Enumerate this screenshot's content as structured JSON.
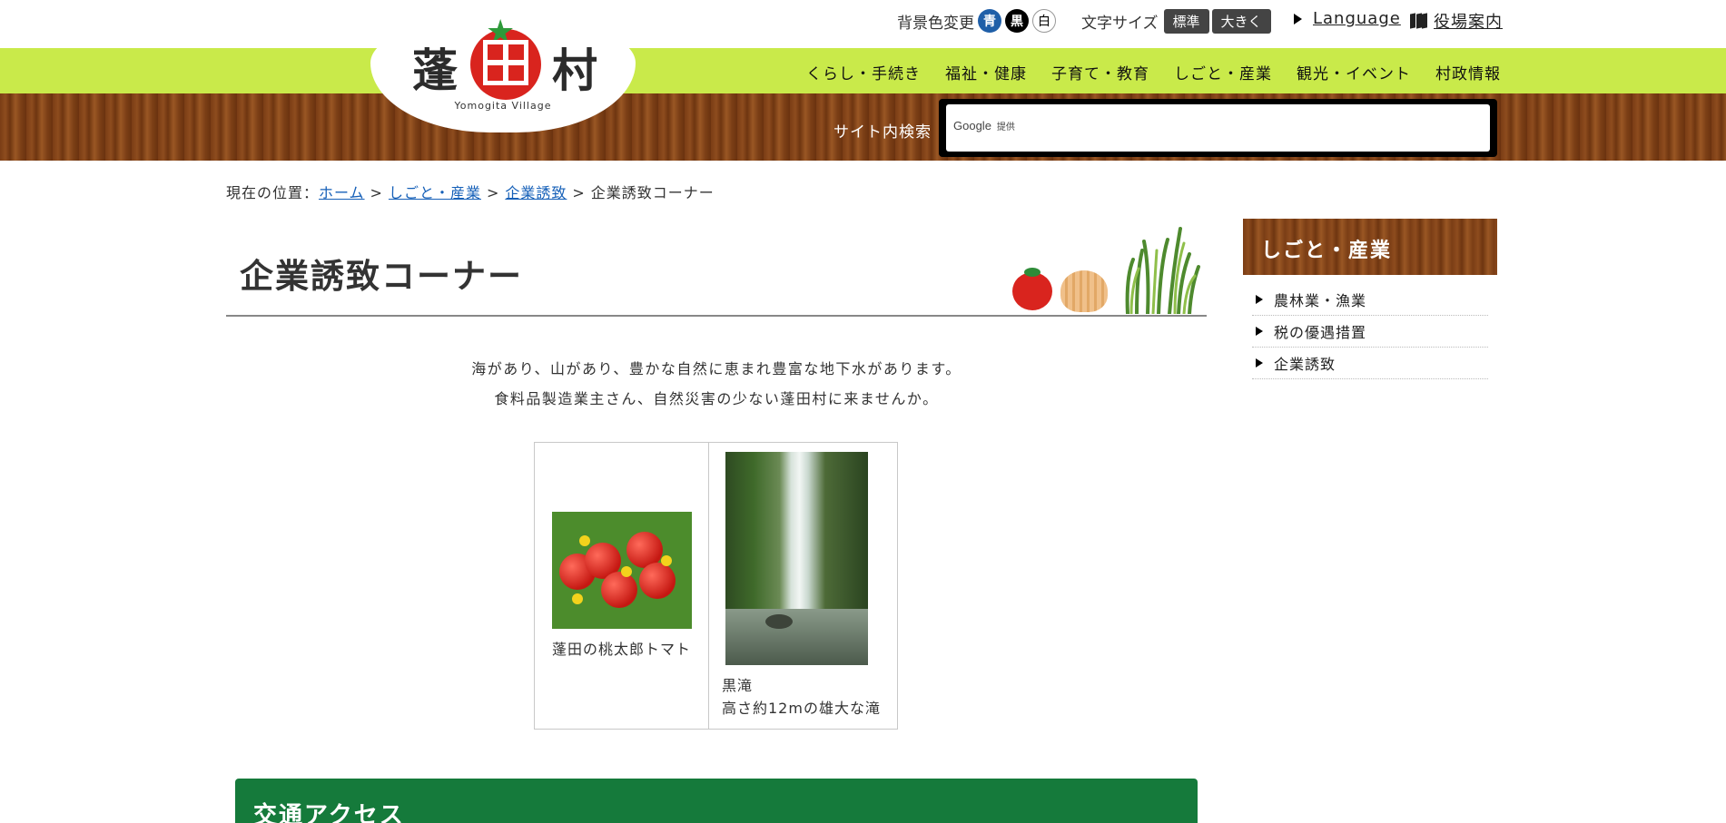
{
  "header": {
    "bg_change_label": "背景色変更",
    "bg_options": [
      "青",
      "黒",
      "白"
    ],
    "font_size_label": "文字サイズ",
    "font_size_options": [
      "標準",
      "大きく"
    ],
    "language_label": "Language",
    "office_guide_label": "役場案内"
  },
  "logo": {
    "kanji_1": "蓬",
    "kanji_3": "村",
    "subtitle": "Yomogita Village"
  },
  "nav": {
    "items": [
      "くらし・手続き",
      "福祉・健康",
      "子育て・教育",
      "しごと・産業",
      "観光・イベント",
      "村政情報"
    ]
  },
  "search": {
    "label": "サイト内検索",
    "google_text": "Google",
    "provided_text": "提供"
  },
  "breadcrumb": {
    "prefix": "現在の位置：",
    "items": [
      "ホーム",
      "しごと・産業",
      "企業誘致"
    ],
    "current": "企業誘致コーナー",
    "separator": ">"
  },
  "page": {
    "title": "企業誘致コーナー",
    "intro_line_1": "海があり、山があり、豊かな自然に恵まれ豊富な地下水があります。",
    "intro_line_2": "食料品製造業主さん、自然災害の少ない蓬田村に来ませんか。"
  },
  "photos": {
    "tomato_caption": "蓬田の桃太郎トマト",
    "waterfall_caption_1": "黒滝",
    "waterfall_caption_2": "高さ約12mの雄大な滝"
  },
  "section": {
    "access_title": "交通アクセス"
  },
  "sidebar": {
    "heading": "しごと・産業",
    "items": [
      "農林業・漁業",
      "税の優遇措置",
      "企業誘致"
    ]
  },
  "colors": {
    "nav_green": "#c9ea4a",
    "wood_brown": "#7a3d15",
    "section_green": "#157a3b",
    "link_blue": "#1660b8",
    "logo_red": "#d9241e"
  }
}
